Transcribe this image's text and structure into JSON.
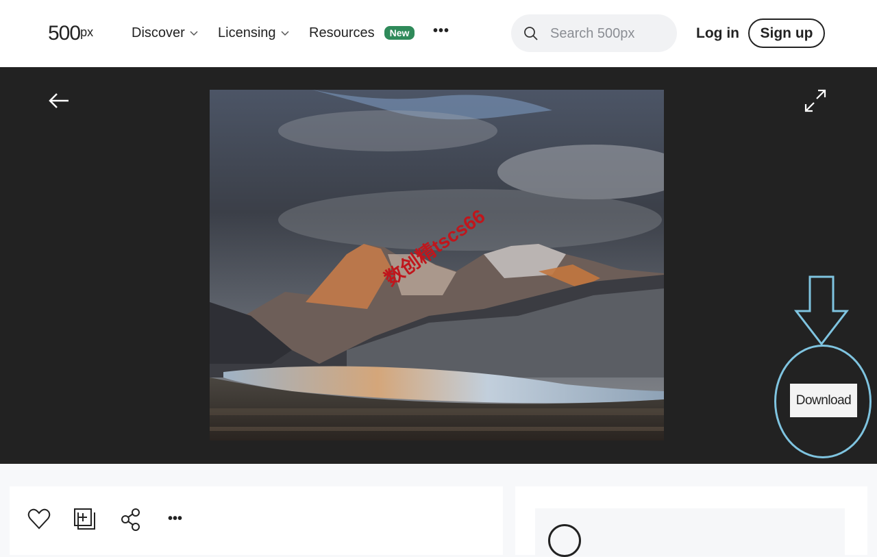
{
  "header": {
    "logo_main": "500",
    "logo_suffix": "px",
    "nav": [
      {
        "label": "Discover"
      },
      {
        "label": "Licensing"
      },
      {
        "label": "Resources",
        "badge": "New"
      }
    ],
    "more_label": "•••",
    "search_placeholder": "Search 500px",
    "login_label": "Log in",
    "signup_label": "Sign up"
  },
  "viewer": {
    "watermark_text": "数创精tscs66",
    "download_label": "Download"
  },
  "actions": {
    "more_label": "•••"
  },
  "colors": {
    "badge_green": "#2f8a5a",
    "viewer_bg": "#222222",
    "annotation_blue": "#7fc4e0",
    "watermark_red": "#c0161c"
  },
  "icons": [
    "back-arrow-icon",
    "expand-icon",
    "search-icon",
    "chevron-down-icon",
    "heart-icon",
    "add-to-gallery-icon",
    "share-icon",
    "avatar-icon"
  ]
}
